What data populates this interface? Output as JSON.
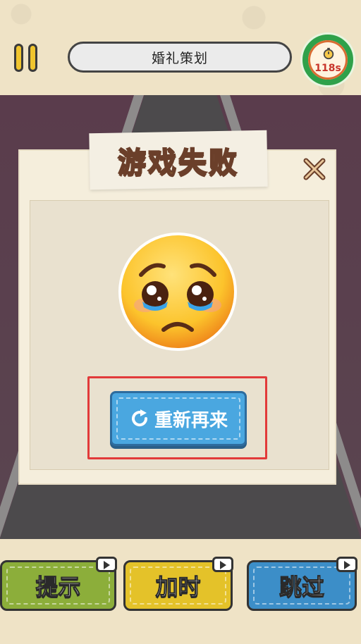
{
  "header": {
    "level_title": "婚礼策划",
    "timer": "118s"
  },
  "dialog": {
    "title": "游戏失败",
    "emoji": "pleading-face-icon",
    "retry_label": "重新再来",
    "retry_icon": "refresh-icon",
    "close_icon": "close-icon"
  },
  "footer": {
    "hint_label": "提示",
    "addtime_label": "加时",
    "skip_label": "跳过"
  },
  "colors": {
    "hint": "#8cae3a",
    "addtime": "#e4c229",
    "skip": "#3c8ec8",
    "retry": "#4aa7e0",
    "highlight": "#e23a3a"
  }
}
